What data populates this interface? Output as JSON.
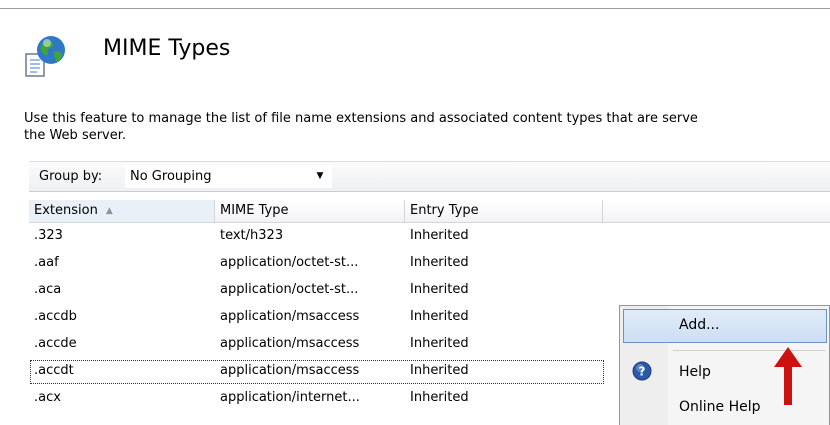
{
  "header": {
    "title": "MIME Types",
    "icon": "globe-document-icon"
  },
  "description": {
    "line1": "Use this feature to manage the list of file name extensions and associated content types that are serve",
    "line2": "the Web server."
  },
  "group_by": {
    "label": "Group by:",
    "selected": "No Grouping",
    "arrow": "▼"
  },
  "table": {
    "columns": {
      "extension": "Extension",
      "mime_type": "MIME Type",
      "entry_type": "Entry Type"
    },
    "sort_indicator": "▲",
    "rows": [
      {
        "extension": ".323",
        "mime_type": "text/h323",
        "entry_type": "Inherited"
      },
      {
        "extension": ".aaf",
        "mime_type": "application/octet-st...",
        "entry_type": "Inherited"
      },
      {
        "extension": ".aca",
        "mime_type": "application/octet-st...",
        "entry_type": "Inherited"
      },
      {
        "extension": ".accdb",
        "mime_type": "application/msaccess",
        "entry_type": "Inherited"
      },
      {
        "extension": ".accde",
        "mime_type": "application/msaccess",
        "entry_type": "Inherited"
      },
      {
        "extension": ".accdt",
        "mime_type": "application/msaccess",
        "entry_type": "Inherited"
      },
      {
        "extension": ".acx",
        "mime_type": "application/internet...",
        "entry_type": "Inherited"
      }
    ]
  },
  "context_menu": {
    "items": [
      {
        "label": "Add..."
      },
      {
        "label": "Help",
        "icon": "help-icon"
      },
      {
        "label": "Online Help"
      }
    ]
  },
  "colors": {
    "menu_highlight_border": "#6d93c6",
    "arrow_red": "#cc1111"
  }
}
